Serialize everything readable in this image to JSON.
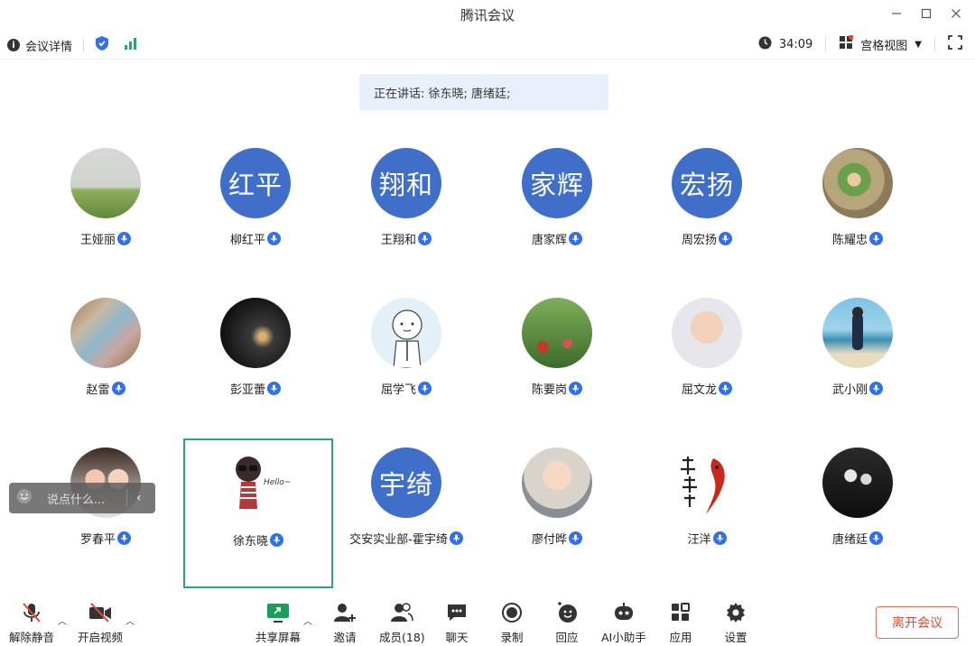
{
  "window": {
    "title": "腾讯会议"
  },
  "infobar": {
    "details_label": "会议详情",
    "timer": "34:09",
    "view_label": "宫格视图"
  },
  "speaking": {
    "text": "正在讲话: 徐东晓; 唐绪廷;"
  },
  "participants": [
    {
      "name": "王娅丽",
      "avatar_type": "photo-field"
    },
    {
      "name": "柳红平",
      "avatar_text": "红平"
    },
    {
      "name": "王翔和",
      "avatar_text": "翔和"
    },
    {
      "name": "唐家辉",
      "avatar_text": "家辉"
    },
    {
      "name": "周宏扬",
      "avatar_text": "宏扬"
    },
    {
      "name": "陈耀忠",
      "avatar_type": "photo-child-outdoor"
    },
    {
      "name": "赵雷",
      "avatar_type": "photo-banknote"
    },
    {
      "name": "彭亚蕾",
      "avatar_type": "photo-night"
    },
    {
      "name": "屈学飞",
      "avatar_type": "cartoon-face"
    },
    {
      "name": "陈要岗",
      "avatar_type": "photo-flowers"
    },
    {
      "name": "屈文龙",
      "avatar_type": "photo-baby"
    },
    {
      "name": "武小刚",
      "avatar_type": "photo-beach"
    },
    {
      "name": "罗春平",
      "avatar_type": "photo-couple"
    },
    {
      "name": "徐东晓",
      "avatar_type": "cartoon-hello",
      "hello_text": "Hello~"
    },
    {
      "name": "交安实业部-霍宇绮",
      "avatar_text": "宇绮"
    },
    {
      "name": "廖付晔",
      "avatar_type": "photo-toddler"
    },
    {
      "name": "汪洋",
      "avatar_type": "calligraphy-koi"
    },
    {
      "name": "唐绪廷",
      "avatar_type": "photo-family-bw"
    }
  ],
  "chat": {
    "placeholder": "说点什么..."
  },
  "toolbar": {
    "unmute": "解除静音",
    "video": "开启视频",
    "share": "共享屏幕",
    "invite": "邀请",
    "members": "成员(18)",
    "chat": "聊天",
    "record": "录制",
    "reaction": "回应",
    "ai": "AI小助手",
    "apps": "应用",
    "settings": "设置",
    "leave": "离开会议"
  },
  "colors": {
    "accent": "#2f6ff0",
    "avatar_blue": "#3f6fc9",
    "active_border": "#2ea66a",
    "leave": "#e04b36"
  }
}
